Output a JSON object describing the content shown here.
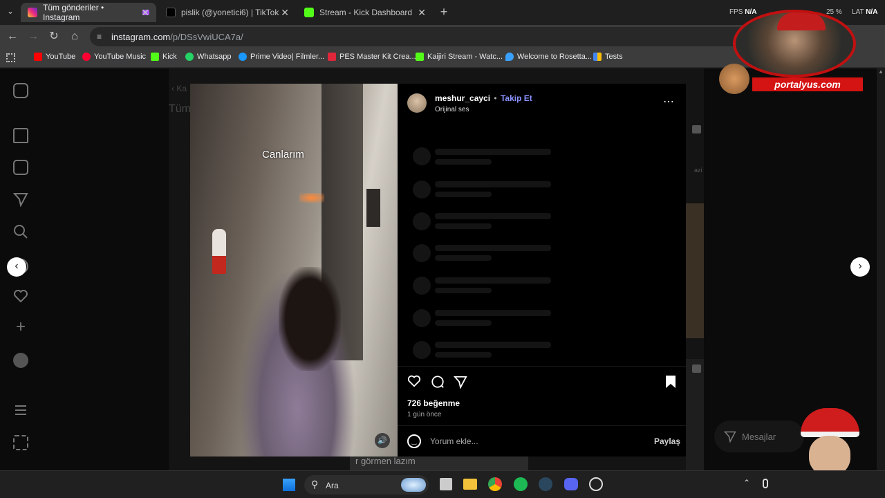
{
  "tabs": [
    {
      "title": "Tüm gönderiler • Instagram",
      "active": true,
      "icon": "instagram-icon"
    },
    {
      "title": "pislik (@yonetici6) | TikTok",
      "active": false,
      "icon": "tiktok-icon"
    },
    {
      "title": "Stream - Kick Dashboard",
      "active": false,
      "icon": "kick-icon"
    }
  ],
  "stats": {
    "fps_label": "FPS",
    "fps_value": "N/A",
    "lat_label": "LAT",
    "lat_value": "N/A",
    "battery": "25 %"
  },
  "address": {
    "host": "instagram.com",
    "path": "/p/DSsVwiUCA7a/"
  },
  "bookmarks": [
    {
      "label": "YouTube",
      "color": "#ff0000"
    },
    {
      "label": "YouTube Music",
      "color": "#ff0033"
    },
    {
      "label": "Kick",
      "color": "#53fc18"
    },
    {
      "label": "Whatsapp",
      "color": "#25d366"
    },
    {
      "label": "Prime Video| Filmler...",
      "color": "#1a98ff"
    },
    {
      "label": "PES Master Kit Crea...",
      "color": "#e0263a"
    },
    {
      "label": "Kaijiri Stream - Watc...",
      "color": "#53fc18"
    },
    {
      "label": "Welcome to Rosetta...",
      "color": "#3aa0ff"
    },
    {
      "label": "Tests",
      "color": "#fbbc04"
    }
  ],
  "overlay": {
    "brand": "portalyus.com"
  },
  "post": {
    "username": "meshur_cayci",
    "dot": "•",
    "follow": "Takip Et",
    "audio": "Orijinal ses",
    "video_caption": "Canlarım",
    "likes": "726 beğenme",
    "time": "1 gün önce",
    "comment_placeholder": "Yorum ekle...",
    "share": "Paylaş"
  },
  "background": {
    "crumb": "Ka",
    "title": "Tüm",
    "subtitle": "r görmen lazım",
    "side_label": "azi"
  },
  "messages": {
    "label": "Mesajlar"
  },
  "taskbar": {
    "search_label": "Ara"
  }
}
